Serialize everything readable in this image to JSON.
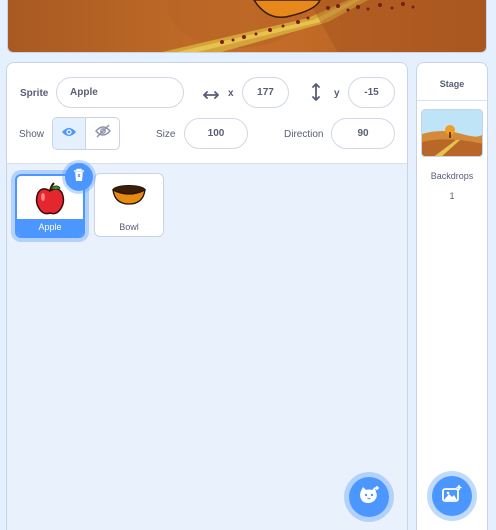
{
  "sprite_info": {
    "sprite_label": "Sprite",
    "sprite_name": "Apple",
    "x_label": "x",
    "x_value": "177",
    "y_label": "y",
    "y_value": "-15",
    "show_label": "Show",
    "size_label": "Size",
    "size_value": "100",
    "direction_label": "Direction",
    "direction_value": "90"
  },
  "sprites": [
    {
      "name": "Apple",
      "selected": true
    },
    {
      "name": "Bowl",
      "selected": false
    }
  ],
  "stage_pane": {
    "title": "Stage",
    "backdrops_label": "Backdrops",
    "backdrops_count": "1"
  },
  "colors": {
    "accent": "#4c97ff",
    "pane_bg": "#e9f1fc",
    "text": "#575e75"
  },
  "icons": {
    "x_axis": "horizontal-arrows-icon",
    "y_axis": "vertical-arrows-icon",
    "show": "eye-icon",
    "hide": "eye-slash-icon",
    "delete": "trash-icon",
    "add_sprite": "cat-add-icon",
    "add_backdrop": "image-add-icon"
  }
}
